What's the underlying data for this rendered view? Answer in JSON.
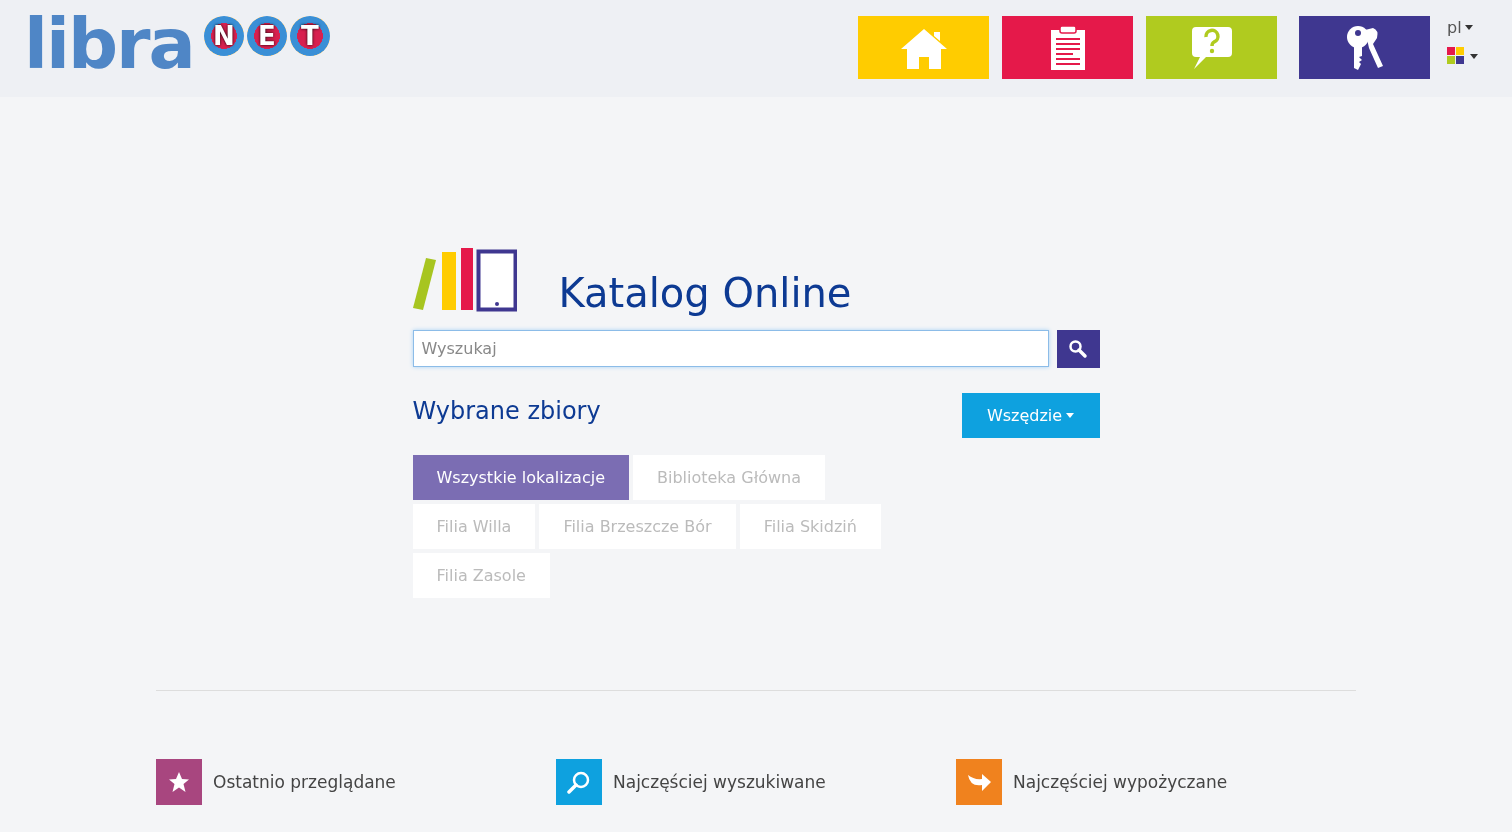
{
  "header": {
    "logo": {
      "word": "libra",
      "letters": [
        "N",
        "E",
        "T"
      ]
    },
    "nav": [
      {
        "kind": "home",
        "color": "#ffcc00"
      },
      {
        "kind": "clipboard",
        "color": "#e5194a"
      },
      {
        "kind": "help",
        "color": "#b0cb1f"
      },
      {
        "kind": "keys",
        "color": "#3f3790"
      }
    ],
    "language": "pl"
  },
  "catalog": {
    "title": "Katalog Online",
    "search": {
      "placeholder": "Wyszukaj"
    },
    "collections_heading": "Wybrane zbiory",
    "scope_button": "Wszędzie",
    "locations": [
      {
        "label": "Wszystkie lokalizacje",
        "selected": true
      },
      {
        "label": "Biblioteka Główna",
        "selected": false
      },
      {
        "label": "Filia Willa",
        "selected": false
      },
      {
        "label": "Filia Brzeszcze Bór",
        "selected": false
      },
      {
        "label": "Filia Skidziń",
        "selected": false
      },
      {
        "label": "Filia Zasole",
        "selected": false
      }
    ]
  },
  "footer_links": [
    {
      "kind": "star",
      "label": "Ostatnio przeglądane",
      "color": "#a8467f"
    },
    {
      "kind": "search",
      "label": "Najczęściej wyszukiwane",
      "color": "#0ea1df"
    },
    {
      "kind": "share",
      "label": "Najczęściej wypożyczane",
      "color": "#f0821e"
    }
  ]
}
